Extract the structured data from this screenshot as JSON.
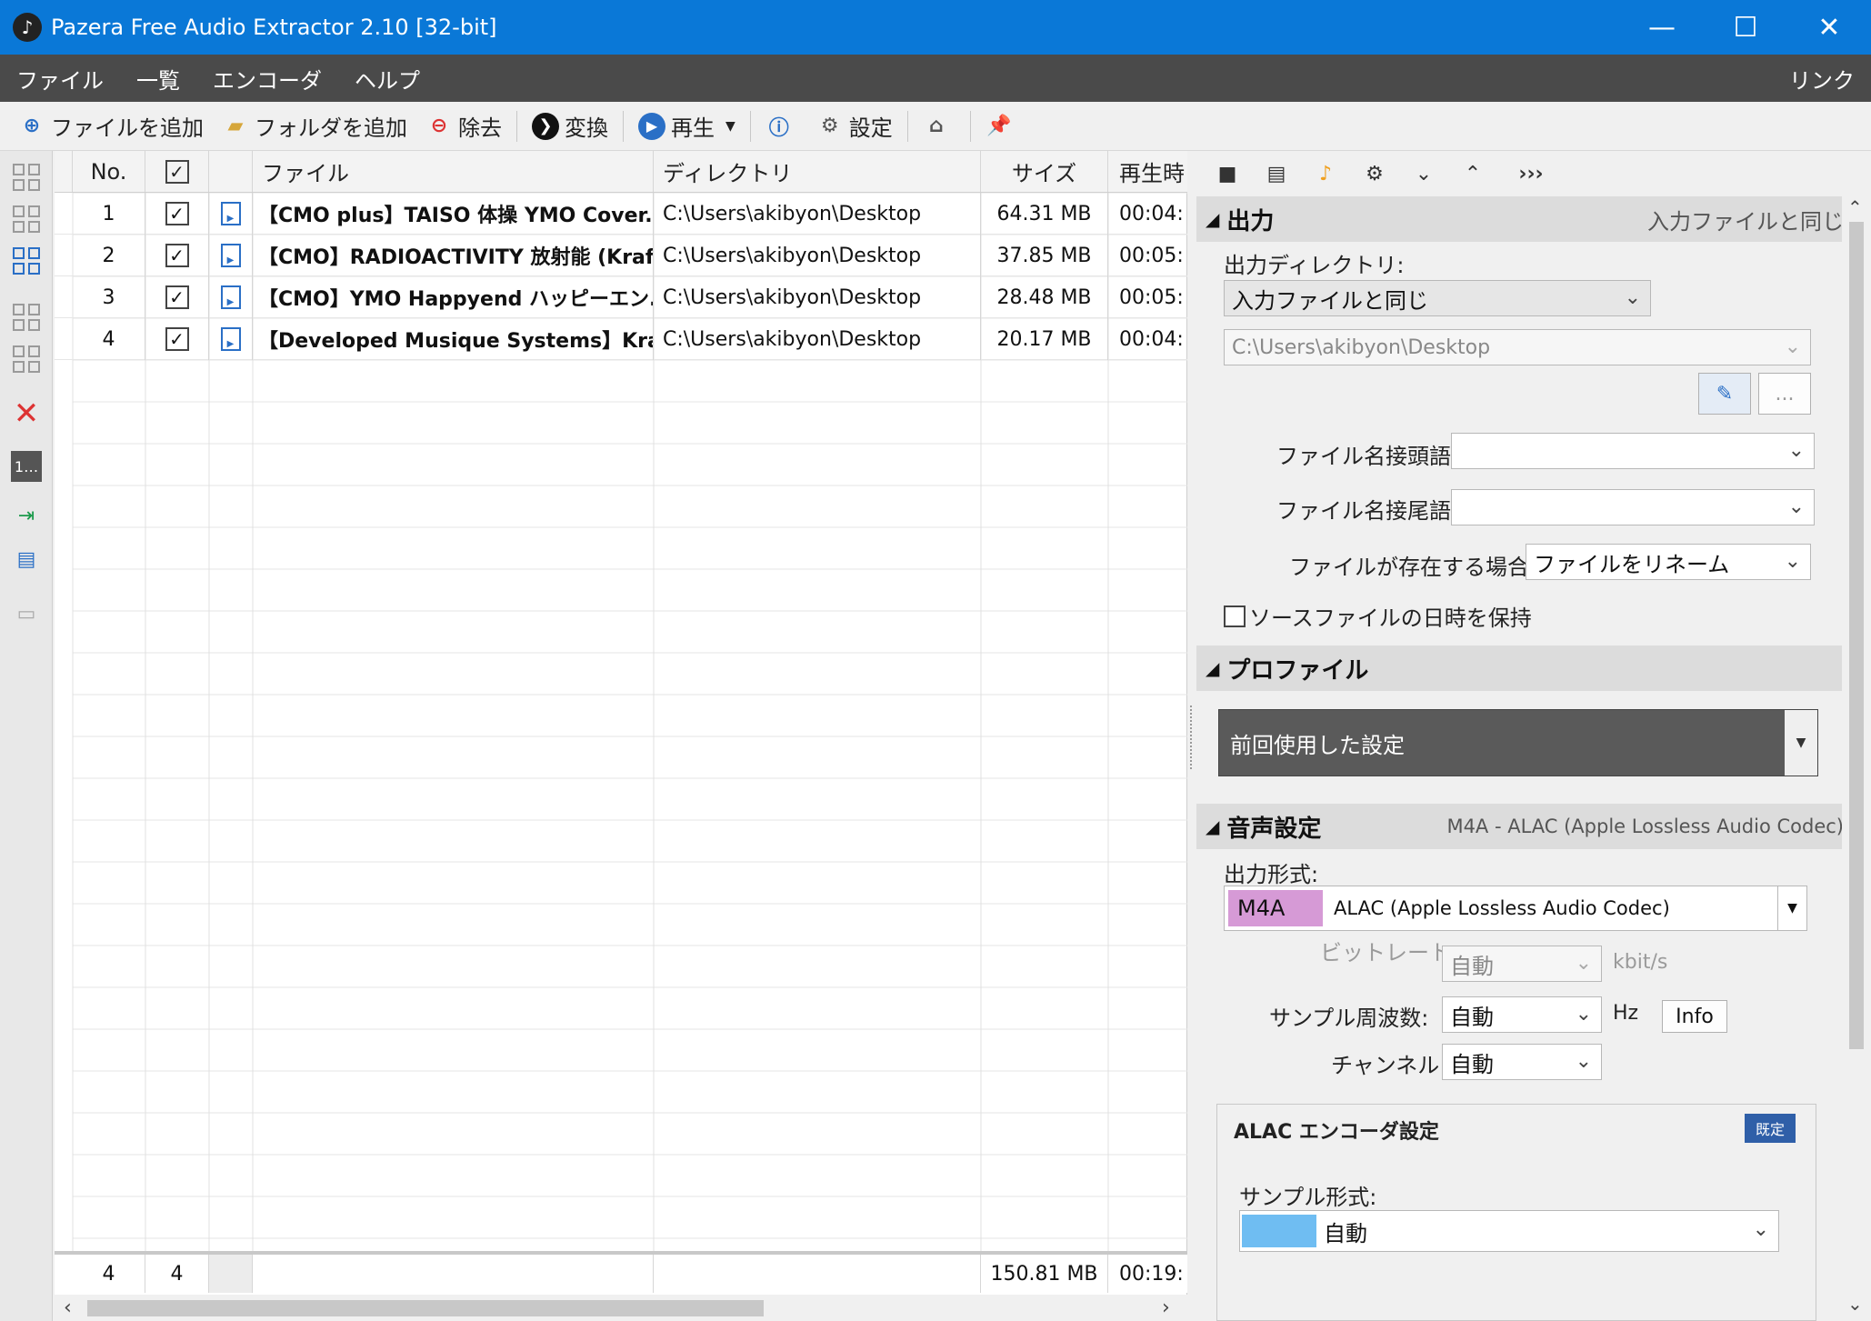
{
  "window": {
    "title": "Pazera Free Audio Extractor 2.10  [32-bit]",
    "minimize": "—",
    "maximize": "☐",
    "close": "✕"
  },
  "menu": {
    "items": [
      "ファイル",
      "一覧",
      "エンコーダ",
      "ヘルプ"
    ],
    "link": "リンク"
  },
  "toolbar": {
    "add_files": "ファイルを追加",
    "add_folder": "フォルダを追加",
    "remove": "除去",
    "convert": "変換",
    "play": "再生",
    "settings": "設定"
  },
  "list": {
    "headers": {
      "no": "No.",
      "file": "ファイル",
      "directory": "ディレクトリ",
      "size": "サイズ",
      "duration": "再生時"
    },
    "rows": [
      {
        "no": "1",
        "file": "【CMO plus】TAISO 体操 YMO Cover.w...",
        "dir": "C:\\Users\\akibyon\\Desktop",
        "size": "64.31 MB",
        "duration": "00:04:"
      },
      {
        "no": "2",
        "file": "【CMO】RADIOACTIVITY 放射能 (Kraft...",
        "dir": "C:\\Users\\akibyon\\Desktop",
        "size": "37.85 MB",
        "duration": "00:05:"
      },
      {
        "no": "3",
        "file": "【CMO】YMO Happyend ハッピーエン...",
        "dir": "C:\\Users\\akibyon\\Desktop",
        "size": "28.48 MB",
        "duration": "00:05:"
      },
      {
        "no": "4",
        "file": "【Developed Musique Systems】Kraftw...",
        "dir": "C:\\Users\\akibyon\\Desktop",
        "size": "20.17 MB",
        "duration": "00:04:"
      }
    ],
    "footer": {
      "count": "4",
      "checked": "4",
      "total_size": "150.81 MB",
      "total_duration": "00:19:"
    }
  },
  "output": {
    "section_title": "出力",
    "section_note": "入力ファイルと同じ",
    "dir_label": "出力ディレクトリ:",
    "dir_mode": "入力ファイルと同じ",
    "dir_path": "C:\\Users\\akibyon\\Desktop",
    "browse_label": "...",
    "prefix_label": "ファイル名接頭語:",
    "suffix_label": "ファイル名接尾語:",
    "exists_label": "ファイルが存在する場合:",
    "exists_value": "ファイルをリネーム",
    "keep_date_label": "ソースファイルの日時を保持"
  },
  "profile": {
    "section_title": "プロファイル",
    "value": "前回使用した設定"
  },
  "audio": {
    "section_title": "音声設定",
    "section_note": "M4A - ALAC (Apple Lossless Audio Codec)",
    "format_label": "出力形式:",
    "format_tag": "M4A",
    "format_value": "ALAC (Apple Lossless Audio Codec)",
    "bitrate_label": "ビットレート:",
    "bitrate_value": "自動",
    "bitrate_unit": "kbit/s",
    "samplerate_label": "サンプル周波数:",
    "samplerate_value": "自動",
    "samplerate_unit": "Hz",
    "info_button": "Info",
    "channels_label": "チャンネル:",
    "channels_value": "自動",
    "encoder_title": "ALAC エンコーダ設定",
    "default_button": "既定",
    "sample_format_label": "サンプル形式:",
    "sample_format_value": "自動"
  },
  "colors": {
    "titlebar": "#0a78d7",
    "menubar": "#4a4a4a",
    "format_tag": "#d69ad6",
    "sample_swatch": "#6fbdf2"
  }
}
